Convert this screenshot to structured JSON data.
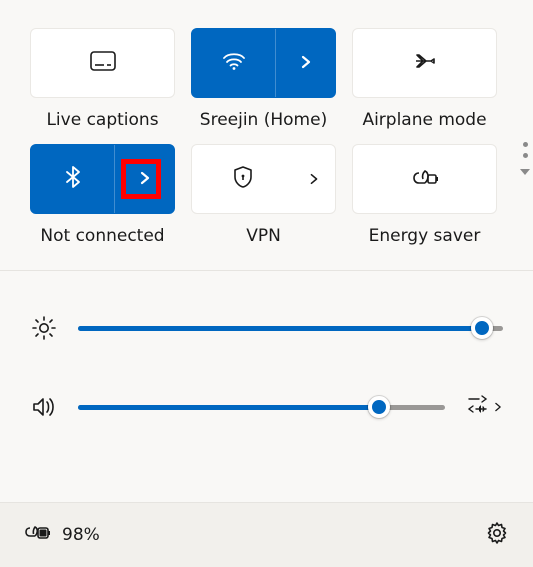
{
  "tiles": {
    "captions": {
      "label": "Live captions"
    },
    "wifi": {
      "label": "Sreejin (Home)"
    },
    "airplane": {
      "label": "Airplane mode"
    },
    "bluetooth": {
      "label": "Not connected"
    },
    "vpn": {
      "label": "VPN"
    },
    "energy": {
      "label": "Energy saver"
    }
  },
  "sliders": {
    "brightness": {
      "percent": 95
    },
    "volume": {
      "percent": 82
    }
  },
  "battery": {
    "text": "98%"
  },
  "colors": {
    "accent": "#0067c0",
    "highlight": "#ff0000"
  }
}
